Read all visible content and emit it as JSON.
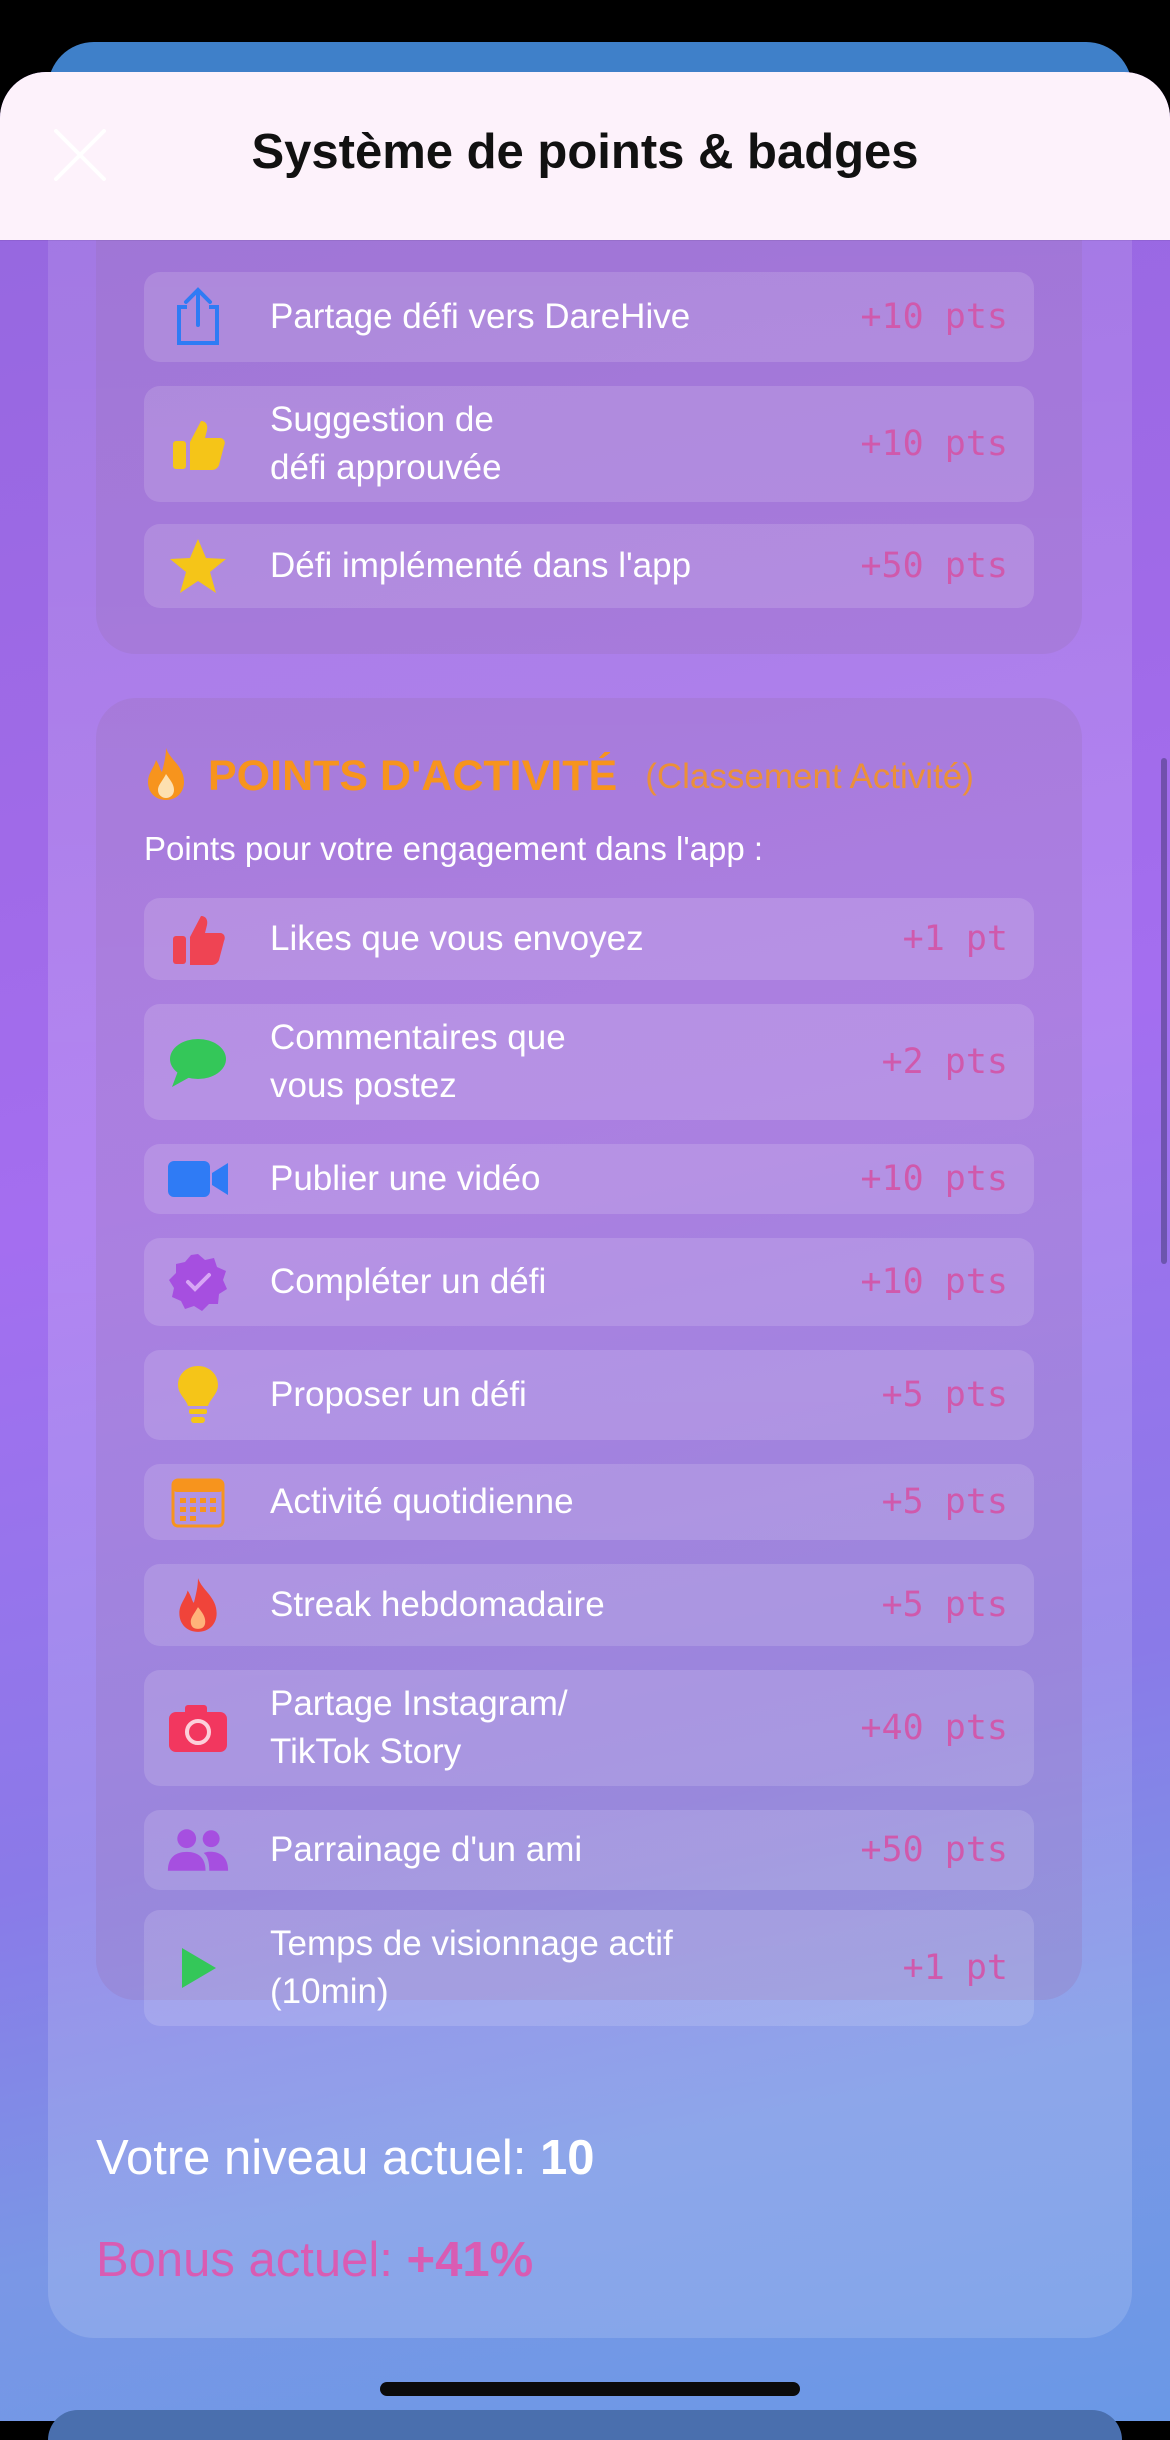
{
  "header": {
    "title": "Système de points & badges",
    "close": "close-icon"
  },
  "top_section": {
    "rows": [
      {
        "icon": "share-icon",
        "label": "Partage défi vers DareHive",
        "points": "+10 pts"
      },
      {
        "icon": "thumbs-up-icon",
        "label": "Suggestion de\ndéfi approuvée",
        "points": "+10 pts"
      },
      {
        "icon": "star-icon",
        "label": "Défi implémenté dans l'app",
        "points": "+50 pts"
      }
    ]
  },
  "activity_section": {
    "title": "POINTS D'ACTIVITÉ",
    "subtitle": "(Classement Activité)",
    "intro": "Points pour votre engagement dans l'app :",
    "rows": [
      {
        "icon": "thumbs-up-icon",
        "label": "Likes que vous envoyez",
        "points": "+1 pt"
      },
      {
        "icon": "speech-bubble-icon",
        "label": "Commentaires que\nvous postez",
        "points": "+2 pts"
      },
      {
        "icon": "video-camera-icon",
        "label": "Publier une vidéo",
        "points": "+10 pts"
      },
      {
        "icon": "check-badge-icon",
        "label": "Compléter un défi",
        "points": "+10 pts"
      },
      {
        "icon": "lightbulb-icon",
        "label": "Proposer un défi",
        "points": "+5 pts"
      },
      {
        "icon": "calendar-icon",
        "label": "Activité quotidienne",
        "points": "+5 pts"
      },
      {
        "icon": "flame-icon",
        "label": "Streak hebdomadaire",
        "points": "+5 pts"
      },
      {
        "icon": "camera-icon",
        "label": "Partage Instagram/\nTikTok Story",
        "points": "+40 pts"
      },
      {
        "icon": "people-icon",
        "label": "Parrainage d'un ami",
        "points": "+50 pts"
      },
      {
        "icon": "play-icon",
        "label": "Temps de visionnage actif\n(10min)",
        "points": "+1 pt"
      }
    ]
  },
  "footer": {
    "level_label": "Votre niveau actuel: ",
    "level_value": "10",
    "bonus_label": "Bonus actuel: ",
    "bonus_value": "+41%"
  },
  "colors": {
    "accent_orange": "#f7941d",
    "points_pink": "#d059ac",
    "bonus_pink": "#d95cb3"
  }
}
